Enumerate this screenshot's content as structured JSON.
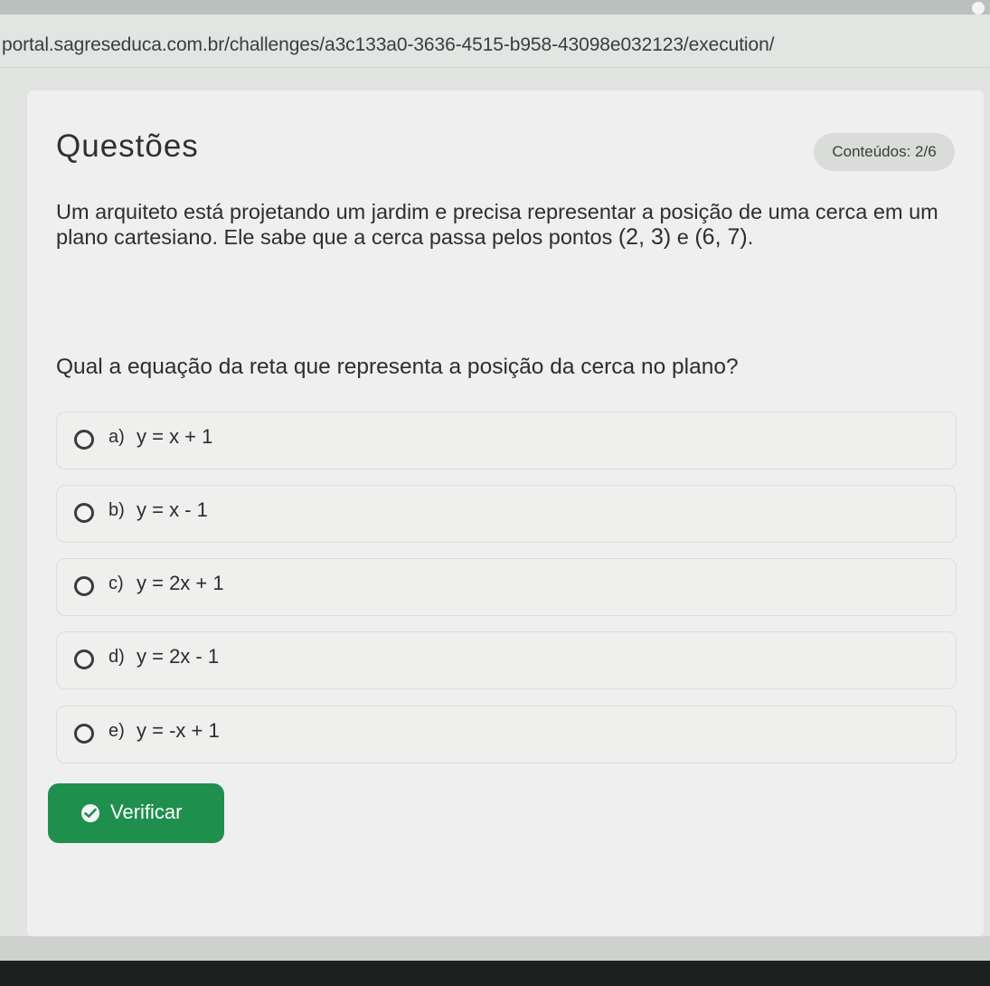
{
  "browser": {
    "url": "portal.sagreseduca.com.br/challenges/a3c133a0-3636-4515-b958-43098e032123/execution/"
  },
  "header": {
    "title": "Questões",
    "badge": "Conteúdos: 2/6"
  },
  "question": {
    "statement_start": "Um arquiteto está projetando um jardim e precisa representar a posição de uma cerca em um plano cartesiano. Ele sabe que a cerca passa pelos pontos ",
    "point_a": "(2, 3)",
    "connector": " e ",
    "point_b": "(6, 7)",
    "statement_end": ".",
    "prompt": "Qual a equação da reta que representa a posição da cerca no plano?"
  },
  "options": [
    {
      "letter": "a)",
      "equation": "y = x + 1"
    },
    {
      "letter": "b)",
      "equation": "y = x - 1"
    },
    {
      "letter": "c)",
      "equation": "y = 2x + 1"
    },
    {
      "letter": "d)",
      "equation": "y = 2x - 1"
    },
    {
      "letter": "e)",
      "equation": "y = -x + 1"
    }
  ],
  "actions": {
    "verify_label": "Verificar"
  },
  "colors": {
    "verify_button": "#1f8f4e",
    "background": "#eeefee",
    "text": "#2d2e30"
  },
  "icons": {
    "verify": "check-circle-icon",
    "option": "radio-icon"
  }
}
